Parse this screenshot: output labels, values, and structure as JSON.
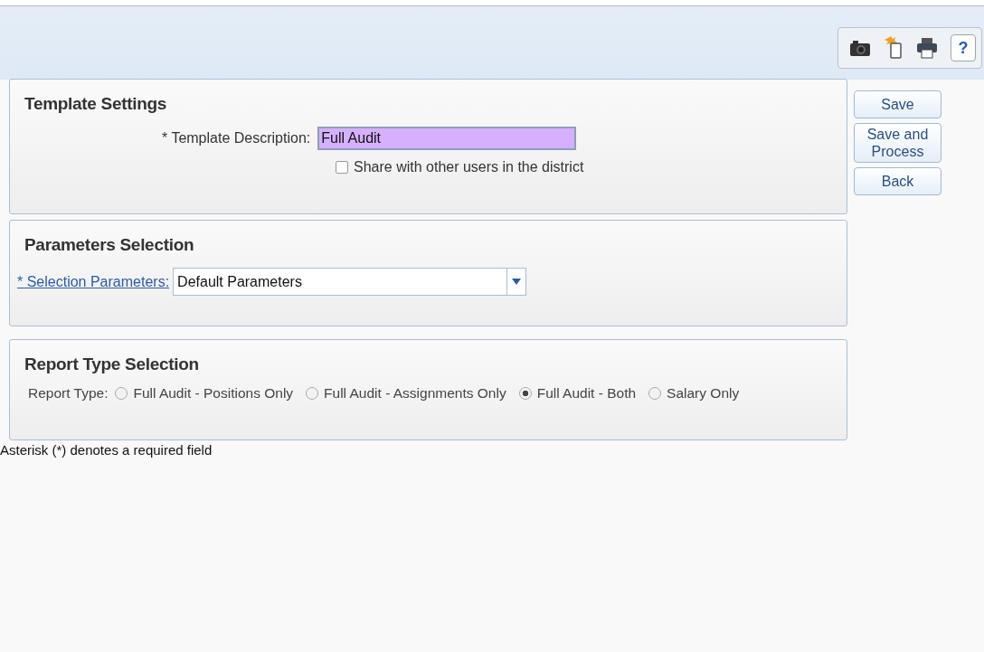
{
  "toolbar": {
    "tools": [
      {
        "kind": "camera"
      },
      {
        "kind": "document"
      },
      {
        "kind": "print"
      },
      {
        "kind": "help",
        "label": "?"
      }
    ]
  },
  "template_settings": {
    "title": "Template Settings",
    "description_label": "* Template Description:",
    "description_value": "Full Audit",
    "share": {
      "label": "Share with other users in the district",
      "checked": false
    }
  },
  "parameters_selection": {
    "title": "Parameters Selection",
    "link_label": "* Selection Parameters:",
    "value": "Default Parameters"
  },
  "report_type_selection": {
    "title": "Report Type Selection",
    "label": "Report Type:",
    "options": [
      {
        "label": "Full Audit - Positions Only",
        "selected": false
      },
      {
        "label": "Full Audit - Assignments Only",
        "selected": false
      },
      {
        "label": "Full Audit - Both",
        "selected": true
      },
      {
        "label": "Salary Only",
        "selected": false
      }
    ]
  },
  "note": "Asterisk (*) denotes a required field",
  "buttons": [
    "Save",
    "Save and Process",
    "Back"
  ]
}
